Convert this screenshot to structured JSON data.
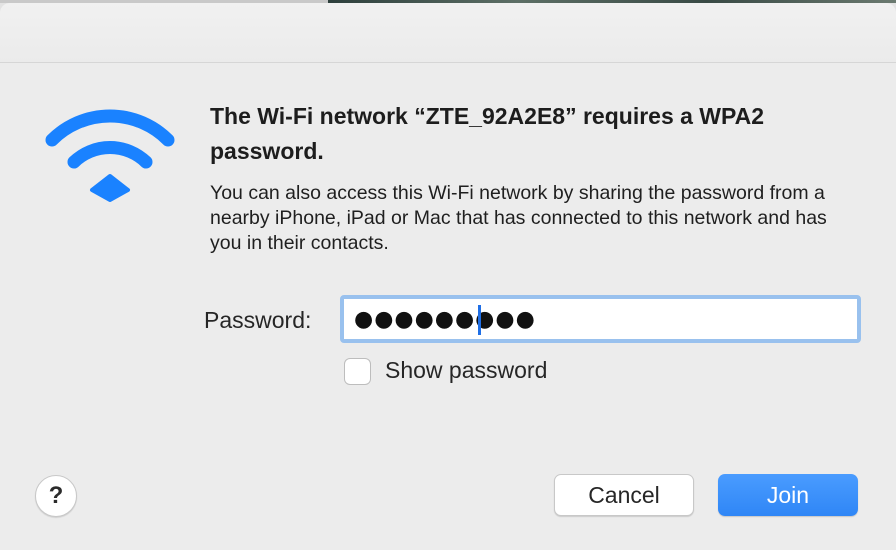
{
  "dialog": {
    "heading": "The Wi-Fi network “ZTE_92A2E8” requires a WPA2 password.",
    "description": "You can also access this Wi-Fi network by sharing the password from a nearby iPhone, iPad or Mac that has connected to this network and has you in their contacts.",
    "icon": "wifi-icon"
  },
  "password": {
    "label": "Password:",
    "value": "●●●●●●●●●"
  },
  "show_password": {
    "label": "Show password",
    "checked": false
  },
  "buttons": {
    "help": "?",
    "cancel": "Cancel",
    "join": "Join"
  },
  "colors": {
    "accent": "#2f86f6",
    "wifi_icon": "#1a82ff",
    "focus_ring": "#99c1ee"
  }
}
